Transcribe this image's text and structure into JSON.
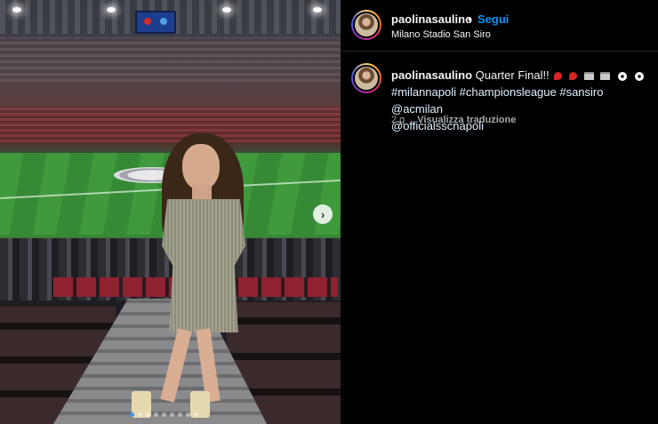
{
  "post_header": {
    "username": "paolinasaulino",
    "separator": "•",
    "follow_label": "Segui",
    "location": "Milano Stadio San Siro"
  },
  "caption": {
    "username": "paolinasaulino",
    "text": "Quarter Final!!",
    "emojis": [
      "pepper-icon",
      "pepper-icon",
      "stadium-icon",
      "stadium-icon",
      "soccer-ball-icon",
      "soccer-ball-icon"
    ],
    "tags_line1": "#milannapoli #championsleague #sansiro @acmilan",
    "tags_line2": "@officialsscnapoli"
  },
  "meta": {
    "time_ago": "2 g",
    "translate_label": "Visualizza traduzione"
  },
  "carousel": {
    "next_icon": "chevron-right-icon",
    "total_slides": 9,
    "active_slide": 1
  },
  "colors": {
    "background": "#000000",
    "follow_blue": "#0095f6",
    "secondary_text": "#a8a8a8",
    "active_dot": "#3897f0"
  }
}
